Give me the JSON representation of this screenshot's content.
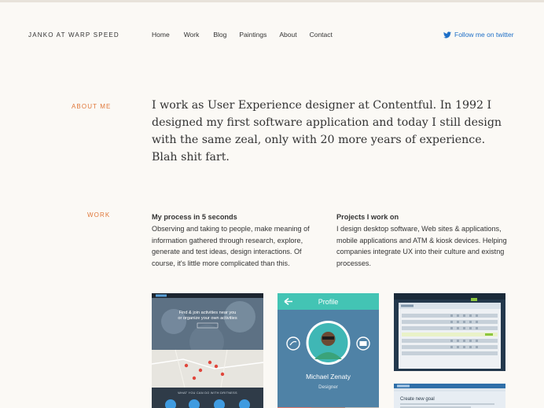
{
  "header": {
    "brand": "JANKO AT WARP SPEED",
    "nav": [
      "Home",
      "Work",
      "Blog",
      "Paintings",
      "About",
      "Contact"
    ],
    "twitter_label": "Follow me on twitter"
  },
  "about": {
    "label": "ABOUT ME",
    "text": "I work as User Experience designer at Contentful. In 1992 I designed my first software application and today I still design with the same zeal, only with 20 more years of experience. Blah shit fart."
  },
  "work": {
    "label": "WORK",
    "process": {
      "title": "My process in 5 seconds",
      "text": "Observing and taking to people, make meaning of information gathered through research, explore, generate and test ideas, design interactions. Of course, it's little more complicated than this."
    },
    "projects": {
      "title": "Projects I work on",
      "text": "I design desktop software, Web sites & applications, mobile applications and ATM & kiosk devices. Helping companies integrate UX into their culture and existng processes."
    }
  },
  "thumbnails": {
    "site": {
      "hero_text": "Find & join activities near you or organize your own activities",
      "band_text": "WHAT YOU CAN DO WITH DRITNESS"
    },
    "profile": {
      "header": "Profile",
      "name": "Michael Zenaty",
      "role": "Designer"
    },
    "dashboard": {
      "title": "Create new goal"
    }
  },
  "colors": {
    "background": "#fbf9f5",
    "accent": "#e0783a",
    "link": "#1d6fc7",
    "teal": "#43c4b4"
  }
}
